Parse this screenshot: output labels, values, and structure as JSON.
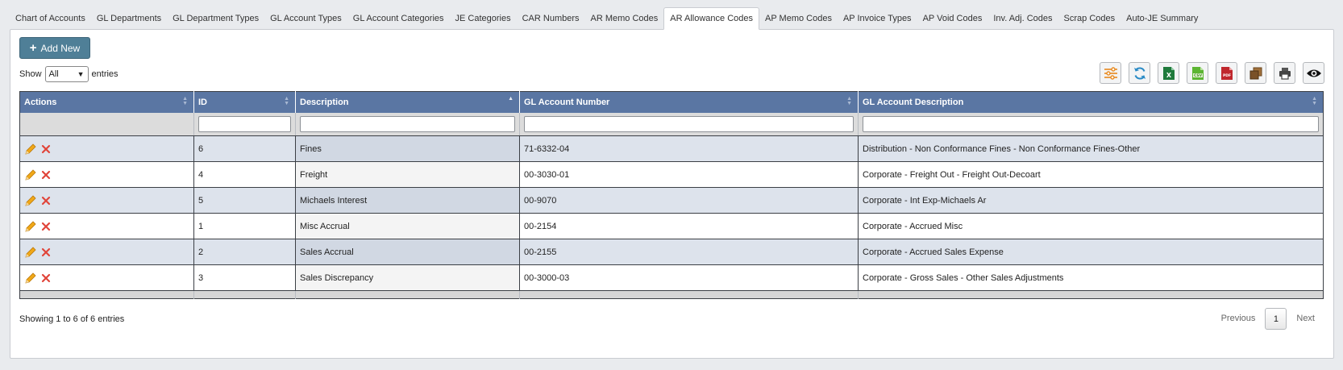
{
  "tabs": [
    {
      "label": "Chart of Accounts",
      "active": false
    },
    {
      "label": "GL Departments",
      "active": false
    },
    {
      "label": "GL Department Types",
      "active": false
    },
    {
      "label": "GL Account Types",
      "active": false
    },
    {
      "label": "GL Account Categories",
      "active": false
    },
    {
      "label": "JE Categories",
      "active": false
    },
    {
      "label": "CAR Numbers",
      "active": false
    },
    {
      "label": "AR Memo Codes",
      "active": false
    },
    {
      "label": "AR Allowance Codes",
      "active": true
    },
    {
      "label": "AP Memo Codes",
      "active": false
    },
    {
      "label": "AP Invoice Types",
      "active": false
    },
    {
      "label": "AP Void Codes",
      "active": false
    },
    {
      "label": "Inv. Adj. Codes",
      "active": false
    },
    {
      "label": "Scrap Codes",
      "active": false
    },
    {
      "label": "Auto-JE Summary",
      "active": false
    }
  ],
  "add_button": {
    "label": "Add New",
    "icon": "plus-icon"
  },
  "show": {
    "prefix": "Show",
    "value": "All",
    "suffix": "entries"
  },
  "toolbar": [
    {
      "name": "column-settings-button",
      "icon": "sliders-icon"
    },
    {
      "name": "refresh-button",
      "icon": "refresh-icon"
    },
    {
      "name": "export-excel-button",
      "icon": "excel-icon"
    },
    {
      "name": "export-csv-button",
      "icon": "csv-icon"
    },
    {
      "name": "export-pdf-button",
      "icon": "pdf-icon"
    },
    {
      "name": "copy-button",
      "icon": "copy-icon"
    },
    {
      "name": "print-button",
      "icon": "print-icon"
    },
    {
      "name": "view-button",
      "icon": "eye-icon"
    }
  ],
  "table": {
    "columns": [
      "Actions",
      "ID",
      "Description",
      "GL Account Number",
      "GL Account Description"
    ],
    "rows": [
      {
        "id": "6",
        "description": "Fines",
        "gl_number": "71-6332-04",
        "gl_description": "Distribution - Non Conformance Fines - Non Conformance Fines-Other"
      },
      {
        "id": "4",
        "description": "Freight",
        "gl_number": "00-3030-01",
        "gl_description": "Corporate - Freight Out - Freight Out-Decoart"
      },
      {
        "id": "5",
        "description": "Michaels Interest",
        "gl_number": "00-9070",
        "gl_description": "Corporate - Int Exp-Michaels Ar"
      },
      {
        "id": "1",
        "description": "Misc Accrual",
        "gl_number": "00-2154",
        "gl_description": "Corporate - Accrued Misc"
      },
      {
        "id": "2",
        "description": "Sales Accrual",
        "gl_number": "00-2155",
        "gl_description": "Corporate - Accrued Sales Expense"
      },
      {
        "id": "3",
        "description": "Sales Discrepancy",
        "gl_number": "00-3000-03",
        "gl_description": "Corporate - Gross Sales - Other Sales Adjustments"
      }
    ]
  },
  "footer": {
    "info": "Showing 1 to 6 of 6 entries",
    "previous": "Previous",
    "page": "1",
    "next": "Next"
  },
  "colors": {
    "header": "#5a76a3",
    "add_button": "#4f7f97",
    "edit_icon": "#f0a818",
    "delete_icon": "#e0453a"
  }
}
